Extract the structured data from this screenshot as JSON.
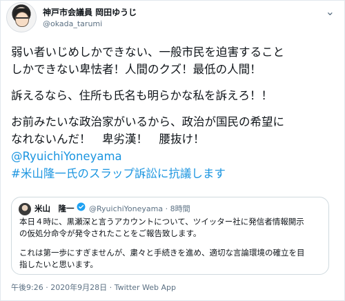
{
  "tweet": {
    "author_name": "神戸市会議員 岡田ゆうじ",
    "author_handle": "@okada_tarumi",
    "more_icon": "⌄",
    "lines": [
      "弱い者いじめしかできない、一般市民を迫害すること",
      "しかできない卑怯者！人間のクズ！最低の人間！",
      "訴えるなら、住所も氏名も明らかな私を訴えろ！！",
      "お前みたいな政治家がいるから、政治が国民の希望に",
      "なれないんだ！　卑劣漢！　腰抜け！"
    ],
    "mention": "@RyuichiYoneyama",
    "hashtag": "#米山隆一氏のスラップ訴訟に抗議します"
  },
  "quoted_tweet": {
    "author_name": "米山　隆一",
    "author_handle": "@RyuichiYoneyama",
    "time_ago": "· 8時間",
    "lines": [
      "本日４時に、黒瀬深と言うアカウントについて、ツイッター社に発信者情報開示",
      "の仮処分命令が発令されたことをご報告致します。",
      "これは第一歩にすぎませんが、粛々と手続きを進め、適切な言論環境の確立を目",
      "指したいと思います。"
    ]
  },
  "meta": {
    "timestamp": "午後9:26 · 2020年9月28日 ·",
    "source": "Twitter Web App"
  },
  "colors": {
    "link": "#1b95e0",
    "secondary_text": "#5b7083",
    "border": "#cfd9de",
    "verified": "#1da1f2"
  }
}
